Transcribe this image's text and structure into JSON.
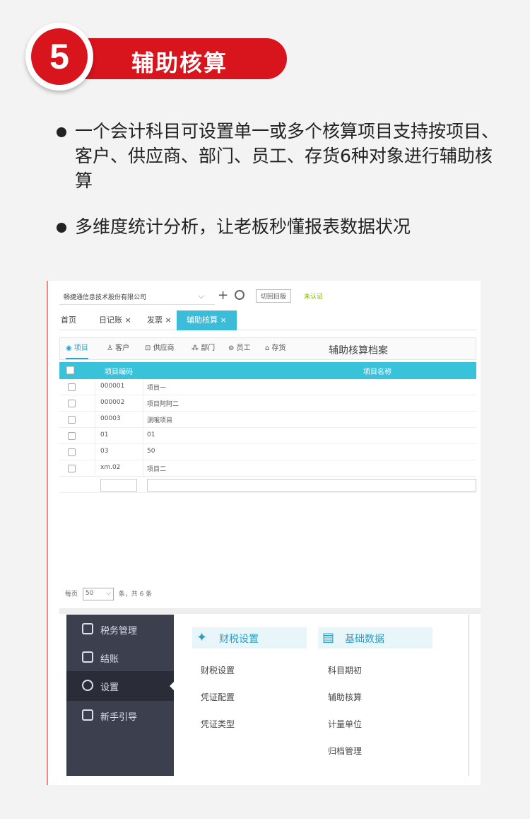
{
  "header": {
    "number": "5",
    "title": "辅助核算"
  },
  "bullets": [
    {
      "text": "一个会计科目可设置单一或多个核算项目支持按项目、客户、供应商、部门、员工、存货6种对象进行辅助核算"
    },
    {
      "text": "多维度统计分析，让老板秒懂报表数据状况"
    }
  ],
  "app": {
    "company": "畅捷通信息技术股份有限公司",
    "switch_label": "切回旧版",
    "status": "未认证",
    "tabs": [
      {
        "label": "首页"
      },
      {
        "label": "日记账 ×"
      },
      {
        "label": "发票 ×"
      },
      {
        "label": "辅助核算 ×"
      }
    ],
    "subtabs": [
      {
        "label": "项目"
      },
      {
        "label": "客户"
      },
      {
        "label": "供应商"
      },
      {
        "label": "部门"
      },
      {
        "label": "员工"
      },
      {
        "label": "存货"
      }
    ],
    "archive_title": "辅助核算档案",
    "columns": {
      "code": "项目编码",
      "name": "项目名称"
    },
    "rows": [
      {
        "code": "000001",
        "name": "项目一"
      },
      {
        "code": "000002",
        "name": "项目阿阿二"
      },
      {
        "code": "00003",
        "name": "测哦项目"
      },
      {
        "code": "01",
        "name": "01"
      },
      {
        "code": "03",
        "name": "50"
      },
      {
        "code": "xm.02",
        "name": "项目二"
      }
    ],
    "pager": {
      "prefix": "每页",
      "page_size": "50",
      "summary": "条，共 6 条"
    }
  },
  "menu": {
    "sidebar": [
      {
        "label": "税务管理",
        "icon": "tax-icon"
      },
      {
        "label": "结账",
        "icon": "checkout-icon"
      },
      {
        "label": "设置",
        "icon": "gear-icon"
      },
      {
        "label": "新手引导",
        "icon": "guide-icon"
      }
    ],
    "sections": [
      {
        "title": "财税设置",
        "icon": "finance-settings-icon",
        "items": [
          "财税设置",
          "凭证配置",
          "凭证类型"
        ]
      },
      {
        "title": "基础数据",
        "icon": "basic-data-icon",
        "items": [
          "科目期初",
          "辅助核算",
          "计量单位",
          "归档管理"
        ]
      }
    ]
  }
}
